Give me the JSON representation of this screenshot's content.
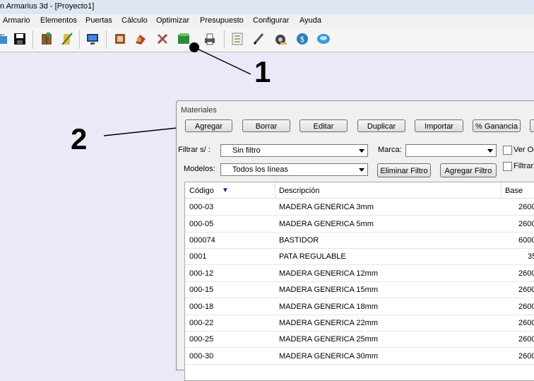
{
  "window_title": "n Armarius 3d - [Proyecto1]",
  "menu": [
    "Armario",
    "Elementos",
    "Puertas",
    "Cálculo",
    "Optimizar",
    "Presupuesto",
    "Configurar",
    "Ayuda"
  ],
  "callouts": {
    "one": "1",
    "two": "2"
  },
  "dialog": {
    "title": "Materiales",
    "buttons": {
      "agregar": "Agregar",
      "borrar": "Borrar",
      "editar": "Editar",
      "duplicar": "Duplicar",
      "importar": "Importar",
      "ganancia": "% Ganancia"
    },
    "filtrar_label": "Filtrar s/ :",
    "filtrar_value": "Sin filtro",
    "marca_label": "Marca:",
    "marca_value": "",
    "ver_ocultos_label": "Ver Oc",
    "modelos_label": "Modelos:",
    "modelos_value": "Todos los líneas",
    "eliminar_filtro": "Eliminar Filtro",
    "agregar_filtro": "Agregar Filtro",
    "filtrar_m_label": "Filtrar M",
    "columns": {
      "codigo": "Código",
      "sort_arrow": "▼",
      "descripcion": "Descripción",
      "base": "Base"
    },
    "rows": [
      {
        "codigo": "000-03",
        "descripcion": "MADERA GENERICA 3mm",
        "base": "2600"
      },
      {
        "codigo": "000-05",
        "descripcion": "MADERA GENERICA 5mm",
        "base": "2600"
      },
      {
        "codigo": "000074",
        "descripcion": "BASTIDOR",
        "base": "6000"
      },
      {
        "codigo": "0001",
        "descripcion": "PATA REGULABLE",
        "base": "35"
      },
      {
        "codigo": "000-12",
        "descripcion": "MADERA GENERICA 12mm",
        "base": "2600"
      },
      {
        "codigo": "000-15",
        "descripcion": "MADERA GENERICA 15mm",
        "base": "2600"
      },
      {
        "codigo": "000-18",
        "descripcion": "MADERA GENERICA 18mm",
        "base": "2600"
      },
      {
        "codigo": "000-22",
        "descripcion": "MADERA GENERICA 22mm",
        "base": "2600"
      },
      {
        "codigo": "000-25",
        "descripcion": "MADERA GENERICA 25mm",
        "base": "2600"
      },
      {
        "codigo": "000-30",
        "descripcion": "MADERA GENERICA 30mm",
        "base": "2600"
      }
    ]
  }
}
